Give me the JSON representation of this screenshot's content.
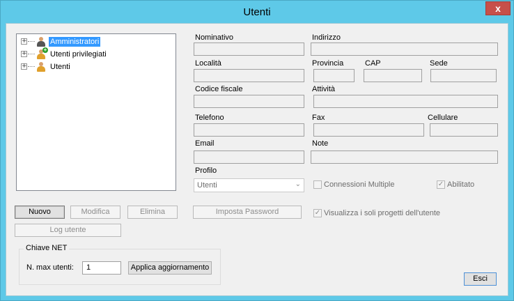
{
  "window": {
    "title": "Utenti",
    "close_glyph": "x"
  },
  "tree": {
    "items": [
      {
        "label": "Amministratori",
        "icon": "admin-users-icon",
        "selected": true,
        "expander": "+"
      },
      {
        "label": "Utenti privilegiati",
        "icon": "add-user-icon",
        "selected": false,
        "expander": "+"
      },
      {
        "label": "Utenti",
        "icon": "users-icon",
        "selected": false,
        "expander": "+"
      }
    ]
  },
  "form": {
    "nominativo": {
      "label": "Nominativo",
      "value": ""
    },
    "indirizzo": {
      "label": "Indirizzo",
      "value": ""
    },
    "localita": {
      "label": "Località",
      "value": ""
    },
    "provincia": {
      "label": "Provincia",
      "value": ""
    },
    "cap": {
      "label": "CAP",
      "value": ""
    },
    "sede": {
      "label": "Sede",
      "value": ""
    },
    "codice_fiscale": {
      "label": "Codice fiscale",
      "value": ""
    },
    "attivita": {
      "label": "Attività",
      "value": ""
    },
    "telefono": {
      "label": "Telefono",
      "value": ""
    },
    "fax": {
      "label": "Fax",
      "value": ""
    },
    "cellulare": {
      "label": "Cellulare",
      "value": ""
    },
    "email": {
      "label": "Email",
      "value": ""
    },
    "note": {
      "label": "Note",
      "value": ""
    },
    "profilo": {
      "label": "Profilo",
      "selected": "Utenti"
    },
    "connessioni_multiple": {
      "label": "Connessioni Multiple",
      "checked": false
    },
    "abilitato": {
      "label": "Abilitato",
      "checked": true
    },
    "visualizza_progetti": {
      "label": "Visualizza i soli progetti dell'utente",
      "checked": true
    }
  },
  "buttons": {
    "nuovo": "Nuovo",
    "modifica": "Modifica",
    "elimina": "Elimina",
    "imposta_password": "Imposta Password",
    "log_utente": "Log utente",
    "applica": "Applica aggiornamento",
    "esci": "Esci"
  },
  "chiave_net": {
    "title": "Chiave NET",
    "max_utenti_label": "N. max utenti:",
    "max_utenti_value": "1"
  },
  "glyphs": {
    "check": "✓",
    "chevron": "⌄"
  }
}
